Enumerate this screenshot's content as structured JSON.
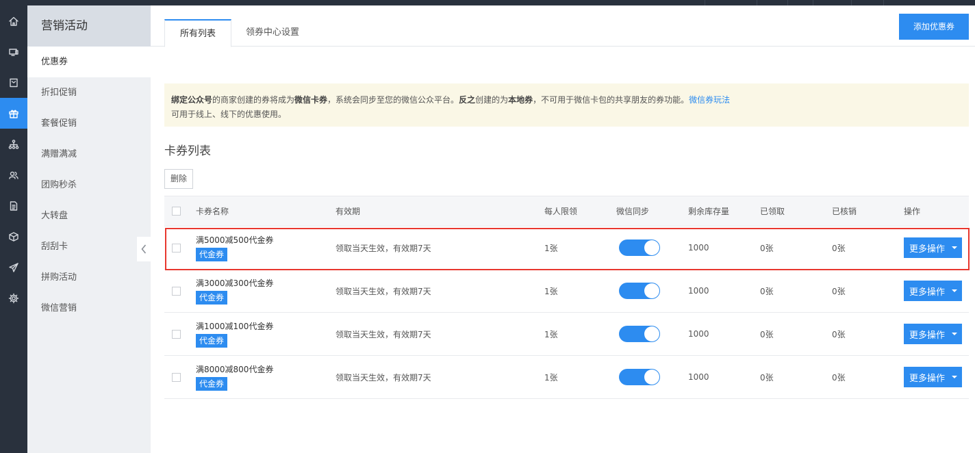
{
  "iconbar": {
    "icons": [
      "home-icon",
      "monitor-icon",
      "message-icon",
      "gift-icon",
      "org-chart-icon",
      "users-icon",
      "document-icon",
      "box-icon",
      "send-icon",
      "gear-icon"
    ],
    "active_index": 3
  },
  "subnav": {
    "title": "营销活动",
    "items": [
      {
        "label": "优惠券"
      },
      {
        "label": "折扣促销"
      },
      {
        "label": "套餐促销"
      },
      {
        "label": "满赠满减"
      },
      {
        "label": "团购秒杀"
      },
      {
        "label": "大转盘"
      },
      {
        "label": "刮刮卡"
      },
      {
        "label": "拼购活动"
      },
      {
        "label": "微信营销"
      }
    ]
  },
  "tabs": [
    {
      "label": "所有列表"
    },
    {
      "label": "领券中心设置"
    }
  ],
  "add_button": "添加优惠券",
  "notice": {
    "b1": "绑定公众号",
    "t1": "的商家创建的券将成为",
    "b2": "微信卡券",
    "t2": "，系统会同步至您的微信公众平台。",
    "b3": "反之",
    "t3": "创建的为",
    "b4": "本地券",
    "t4": "，不可用于微信卡包的共享朋友的券功能。",
    "link": "微信券玩法",
    "line2": "可用于线上、线下的优惠使用。"
  },
  "section_title": "卡券列表",
  "delete_button": "删除",
  "table": {
    "headers": {
      "name": "卡券名称",
      "validity": "有效期",
      "limit": "每人限领",
      "sync": "微信同步",
      "stock": "剩余库存量",
      "claimed": "已领取",
      "redeemed": "已核销",
      "action": "操作"
    },
    "rows": [
      {
        "name": "满5000减500代金券",
        "tag": "代金券",
        "validity": "领取当天生效，有效期7天",
        "limit": "1张",
        "sync_on": true,
        "stock": "1000",
        "claimed": "0张",
        "redeemed": "0张",
        "action": "更多操作"
      },
      {
        "name": "满3000减300代金券",
        "tag": "代金券",
        "validity": "领取当天生效，有效期7天",
        "limit": "1张",
        "sync_on": true,
        "stock": "1000",
        "claimed": "0张",
        "redeemed": "0张",
        "action": "更多操作"
      },
      {
        "name": "满1000减100代金券",
        "tag": "代金券",
        "validity": "领取当天生效，有效期7天",
        "limit": "1张",
        "sync_on": true,
        "stock": "1000",
        "claimed": "0张",
        "redeemed": "0张",
        "action": "更多操作"
      },
      {
        "name": "满8000减800代金券",
        "tag": "代金券",
        "validity": "领取当天生效，有效期7天",
        "limit": "1张",
        "sync_on": true,
        "stock": "1000",
        "claimed": "0张",
        "redeemed": "0张",
        "action": "更多操作"
      }
    ]
  },
  "colors": {
    "accent": "#2d8cf0",
    "sidebar_dark": "#29313d",
    "highlight_border": "#e8372e",
    "notice_bg": "#faf7e6"
  }
}
